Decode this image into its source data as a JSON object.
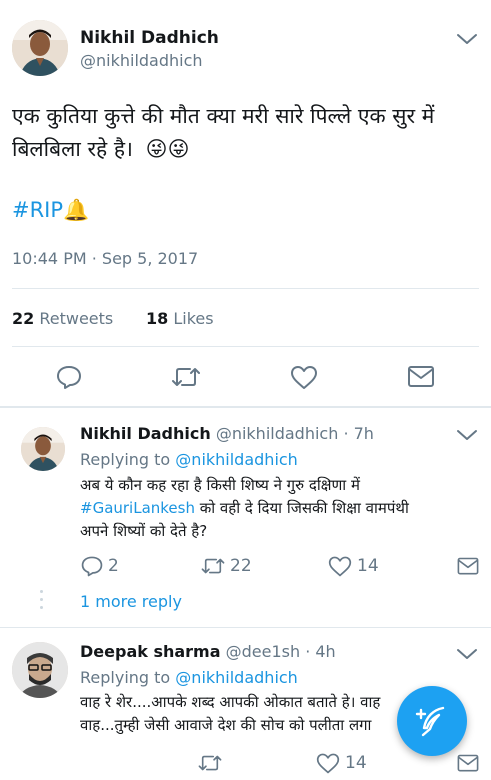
{
  "main_tweet": {
    "display_name": "Nikhil Dadhich",
    "handle": "@nikhildadhich",
    "text_line1": "एक कुतिया कुत्ते की मौत क्या मरी सारे पिल्ले एक सुर में",
    "text_line2": "बिलबिला रहे है।",
    "emoji1": "😜",
    "emoji2": "😜",
    "hashtag": "#RIP",
    "bell_emoji": "🔔",
    "timestamp": "10:44 PM · Sep 5, 2017",
    "retweet_count": "22",
    "retweet_label": "Retweets",
    "like_count": "18",
    "like_label": "Likes"
  },
  "reply1": {
    "display_name": "Nikhil Dadhich",
    "handle": "@nikhildadhich",
    "time": "· 7h",
    "replying_prefix": "Replying to",
    "replying_handle": "@nikhildadhich",
    "text_line1": "अब ये कौन कह रहा है किसी शिष्य ने गुरु दक्षिणा में",
    "hashtag": "#GauriLankesh",
    "text_line2_rest": " को वही दे दिया जिसकी शिक्षा वामपंथी",
    "text_line3": "अपने शिष्यों को देते है?",
    "reply_count": "2",
    "retweet_count": "22",
    "like_count": "14",
    "more_replies": "1 more reply"
  },
  "reply2": {
    "display_name": "Deepak sharma",
    "handle": "@dee1sh",
    "time": "· 4h",
    "replying_prefix": "Replying to",
    "replying_handle": "@nikhildadhich",
    "text_line1": "वाह रे शेर....आपके शब्द आपकी ओकात बताते हे। वाह",
    "text_line2": "वाह...तुम्ही जेसी आवाजे देश की सोच को पलीता लगा",
    "like_count": "14"
  },
  "colors": {
    "accent": "#1da1f2",
    "link": "#1b95e0",
    "muted": "#657786",
    "divider": "#e1e8ed"
  }
}
